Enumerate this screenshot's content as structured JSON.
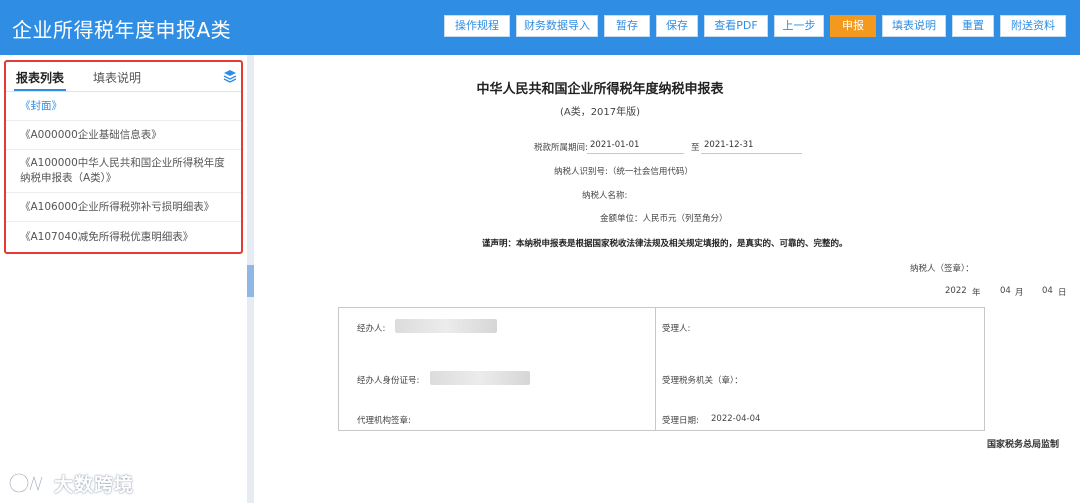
{
  "app": {
    "title": "企业所得税年度申报A类"
  },
  "toolbar": {
    "buttons": [
      {
        "label": "操作规程"
      },
      {
        "label": "财务数据导入"
      },
      {
        "label": "暂存"
      },
      {
        "label": "保存"
      },
      {
        "label": "查看PDF"
      },
      {
        "label": "上一步"
      },
      {
        "label": "申报"
      },
      {
        "label": "填表说明"
      },
      {
        "label": "重置"
      },
      {
        "label": "附送资料"
      }
    ],
    "active_color": "#f39a1e"
  },
  "sidebar": {
    "tabs": [
      {
        "label": "报表列表"
      },
      {
        "label": "填表说明"
      }
    ],
    "icon": "layers-icon",
    "items": [
      {
        "label": "《封面》"
      },
      {
        "label": "《A000000企业基础信息表》"
      },
      {
        "label": "《A100000中华人民共和国企业所得税年度纳税申报表（A类）》"
      },
      {
        "label": "《A106000企业所得税弥补亏损明细表》"
      },
      {
        "label": "《A107040减免所得税优惠明细表》"
      }
    ]
  },
  "form": {
    "title": "中华人民共和国企业所得税年度纳税申报表",
    "subtitle": "(A类，2017年版)",
    "period_label": "税款所属期间:",
    "period_start": "2021-01-01",
    "period_to": "至",
    "period_end": "2021-12-31",
    "taxpayer_id_label": "纳税人识别号:（统一社会信用代码）",
    "taxpayer_name_label": "纳税人名称:",
    "amount_unit_label": "金额单位：人民币元（列至角分）",
    "declaration": "谨声明：本纳税申报表是根据国家税收法律法规及相关规定填报的，是真实的、可靠的、完整的。",
    "signature_label": "纳税人（签章）：",
    "date": {
      "year": "2022",
      "year_label": "年",
      "month": "04",
      "month_label": "月",
      "day": "04",
      "day_label": "日"
    }
  },
  "signature_table": {
    "handler_label": "经办人:",
    "handler_id_label": "经办人身份证号:",
    "agency_seal_label": "代理机构签章:",
    "acceptor_label": "受理人:",
    "tax_office_label": "受理税务机关（章）：",
    "accept_date_label": "受理日期:",
    "accept_date": "2022-04-04"
  },
  "footer": {
    "supervise": "国家税务总局监制"
  },
  "watermark": {
    "text": "大数跨境",
    "icon": "brand-logo-icon"
  },
  "colors": {
    "header": "#2f8de4",
    "highlight_border": "#e53935"
  }
}
